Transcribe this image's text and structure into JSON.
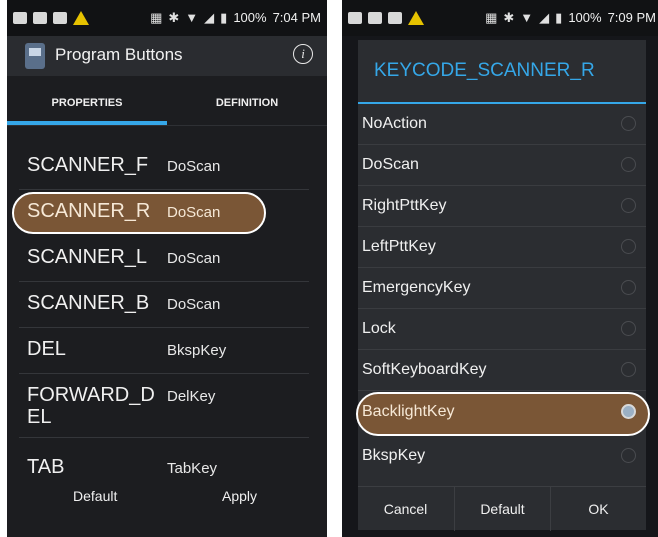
{
  "left": {
    "status_time": "7:04 PM",
    "battery": "100%",
    "app_title": "Program Buttons",
    "tabs": [
      {
        "label": "PROPERTIES"
      },
      {
        "label": "DEFINITION"
      }
    ],
    "rows": [
      {
        "key": "SCANNER_F",
        "value": "DoScan"
      },
      {
        "key": "SCANNER_R",
        "value": "DoScan"
      },
      {
        "key": "SCANNER_L",
        "value": "DoScan"
      },
      {
        "key": "SCANNER_B",
        "value": "DoScan"
      },
      {
        "key": "DEL",
        "value": "BkspKey"
      },
      {
        "key": "FORWARD_DEL",
        "value": "DelKey"
      },
      {
        "key": "TAB",
        "value": "TabKey"
      }
    ],
    "footer": {
      "default": "Default",
      "apply": "Apply"
    }
  },
  "right": {
    "status_time": "7:09 PM",
    "battery": "100%",
    "dialog_title": "KEYCODE_SCANNER_R",
    "options": [
      {
        "label": "NoAction"
      },
      {
        "label": "DoScan"
      },
      {
        "label": "RightPttKey"
      },
      {
        "label": "LeftPttKey"
      },
      {
        "label": "EmergencyKey"
      },
      {
        "label": "Lock"
      },
      {
        "label": "SoftKeyboardKey"
      },
      {
        "label": "BacklightKey"
      },
      {
        "label": "BkspKey"
      }
    ],
    "selected": "BacklightKey",
    "buttons": {
      "cancel": "Cancel",
      "default": "Default",
      "ok": "OK"
    }
  },
  "colors": {
    "accent": "#35a7e8",
    "highlight": "#7a5636"
  },
  "icons": [
    "info-icon",
    "app-icon",
    "radio-button-icon",
    "battery-icon",
    "wifi-icon",
    "bluetooth-icon",
    "warning-icon"
  ]
}
